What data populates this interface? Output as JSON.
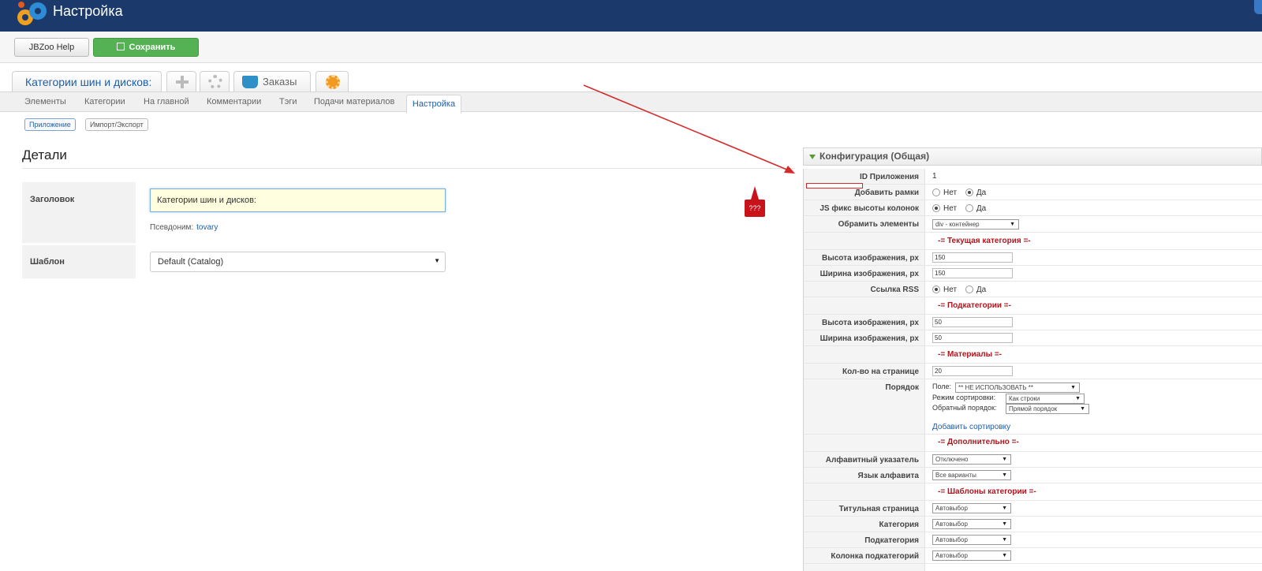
{
  "header": {
    "title": "Настройка",
    "accent": "#1b3a6b"
  },
  "toolbar": {
    "help_label": "JBZoo Help",
    "save_label": "Сохранить",
    "save_color": "#54b254"
  },
  "component_tabs": {
    "app_label": "Категории шин и дисков:",
    "orders_label": "Заказы"
  },
  "subnav": {
    "items": [
      "Элементы",
      "Категории",
      "На главной",
      "Комментарии",
      "Тэги",
      "Подачи материалов"
    ],
    "active": "Настройка"
  },
  "pills": {
    "app": "Приложение",
    "import": "Импорт/Экспорт"
  },
  "details": {
    "heading": "Детали",
    "title_label": "Заголовок",
    "title_value": "Категории шин и дисков:",
    "alias_label": "Псевдоним:",
    "alias_value": "tovary",
    "template_label": "Шаблон",
    "template_value": "Default (Catalog)"
  },
  "annotation": {
    "badge": "???",
    "color": "#c8131b"
  },
  "config": {
    "heading": "Конфигурация (Общая)",
    "app_id_label": "ID Приложения",
    "app_id_value": "1",
    "frames_label": "Добавить рамки",
    "jsfix_label": "JS фикс высоты колонок",
    "wrap_label": "Обрамить элементы",
    "wrap_value": "div - контейнер",
    "opt_no": "Нет",
    "opt_yes": "Да",
    "sec_current": "-= Текущая категория =-",
    "sec_sub": "-= Подкатегории =-",
    "sec_items": "-= Материалы =-",
    "sec_extra": "-= Дополнительно =-",
    "sec_tpl": "-= Шаблоны категории =-",
    "img_h_label": "Высота изображения, px",
    "img_w_label": "Ширина изображения, px",
    "cur_img_h": "150",
    "cur_img_w": "150",
    "rss_label": "Ссылка RSS",
    "sub_img_h": "50",
    "sub_img_w": "50",
    "per_page_label": "Кол-во на странице",
    "per_page_value": "20",
    "order_label": "Порядок",
    "order_field_label": "Поле:",
    "order_field_value": "** НЕ ИСПОЛЬЗОВАТЬ **",
    "order_mode_label": "Режим сортировки:",
    "order_mode_value": "Как строки",
    "order_reverse_label": "Обратный порядок:",
    "order_reverse_value": "Прямой порядок",
    "add_sort": "Добавить сортировку",
    "alpha_index_label": "Алфавитный указатель",
    "alpha_index_value": "Отключено",
    "alpha_lang_label": "Язык алфавита",
    "alpha_lang_value": "Все варианты",
    "tpl_front_label": "Титульная страница",
    "tpl_cat_label": "Категория",
    "tpl_sub_label": "Подкатегория",
    "tpl_subcol_label": "Колонка подкатегорий",
    "auto_value": "Автовыбор"
  }
}
